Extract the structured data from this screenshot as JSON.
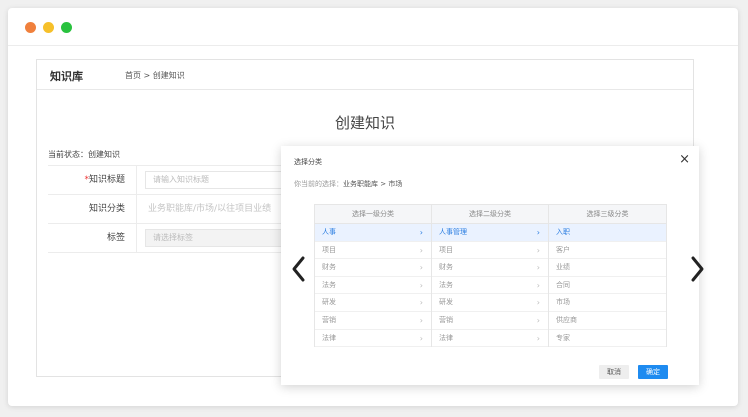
{
  "app": {
    "title": "知识库",
    "breadcrumb": "首页 > 创建知识"
  },
  "page": {
    "title": "创建知识",
    "status": "当前状态：创建知识"
  },
  "form": {
    "title_label_req": "*",
    "title_label": "知识标题",
    "title_placeholder": "请输入知识标题",
    "category_label": "知识分类",
    "category_value": "业务职能库/市场/以往项目业绩",
    "tags_label": "标签",
    "tags_placeholder": "请选择标签"
  },
  "modal": {
    "title": "选择分类",
    "close": "×",
    "selected_prefix": "你当前的选择：",
    "selected_value": "业务职能库 > 市场",
    "columns": [
      {
        "header": "选择一级分类",
        "items": [
          "人事",
          "项目",
          "财务",
          "法务",
          "研发",
          "营销",
          "法律"
        ],
        "active": 0,
        "arrows": true
      },
      {
        "header": "选择二级分类",
        "items": [
          "人事管理",
          "项目",
          "财务",
          "法务",
          "研发",
          "营销",
          "法律"
        ],
        "active": 0,
        "arrows": true
      },
      {
        "header": "选择三级分类",
        "items": [
          "入职",
          "客户",
          "业绩",
          "合同",
          "市场",
          "供应商",
          "专家"
        ],
        "active": 0,
        "arrows": false
      }
    ],
    "cancel": "取消",
    "ok": "确定"
  },
  "colors": {
    "accent": "#1e8bf0",
    "active_bg": "#eaf2ff",
    "required": "#e33333"
  },
  "icons": {
    "prev": "chevron-left-icon",
    "next": "chevron-right-icon"
  }
}
